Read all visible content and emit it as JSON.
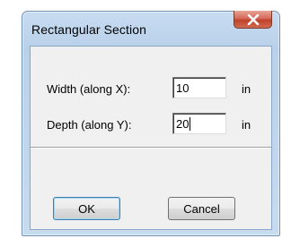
{
  "dialog": {
    "title": "Rectangular Section"
  },
  "fields": {
    "width": {
      "label": "Width (along X):",
      "value": "10",
      "unit": "in"
    },
    "depth": {
      "label": "Depth (along Y):",
      "value": "20",
      "unit": "in"
    }
  },
  "buttons": {
    "ok_label": "OK",
    "cancel_label": "Cancel"
  },
  "icons": {
    "close": "close-icon"
  }
}
